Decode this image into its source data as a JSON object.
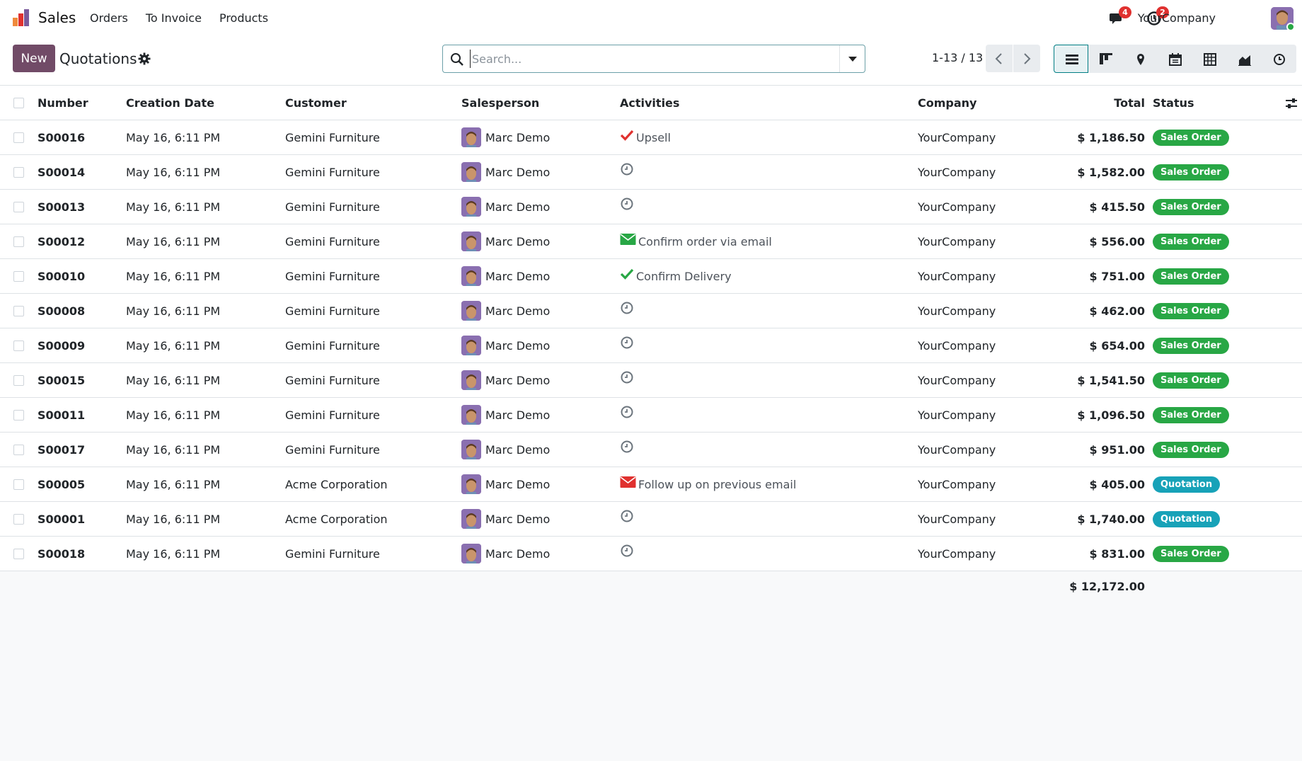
{
  "navbar": {
    "app_name": "Sales",
    "menu": [
      "Orders",
      "To Invoice",
      "Products"
    ],
    "messages_count": "4",
    "activities_count": "2",
    "company": "YourCompany"
  },
  "control": {
    "new_label": "New",
    "title": "Quotations",
    "search_placeholder": "Search...",
    "pager": "1-13 / 13",
    "views": [
      "list-icon",
      "kanban-icon",
      "map-icon",
      "calendar-icon",
      "pivot-icon",
      "graph-icon",
      "activity-icon"
    ]
  },
  "table": {
    "headers": {
      "number": "Number",
      "date": "Creation Date",
      "customer": "Customer",
      "salesperson": "Salesperson",
      "activities": "Activities",
      "company": "Company",
      "total": "Total",
      "status": "Status"
    },
    "rows": [
      {
        "number": "S00016",
        "date": "May 16, 6:11 PM",
        "customer": "Gemini Furniture",
        "salesperson": "Marc Demo",
        "activity_icon": "check-icon",
        "activity_color": "#e0312f",
        "activity": "Upsell",
        "company": "YourCompany",
        "total": "$ 1,186.50",
        "status": "Sales Order",
        "status_color": "#28a745"
      },
      {
        "number": "S00014",
        "date": "May 16, 6:11 PM",
        "customer": "Gemini Furniture",
        "salesperson": "Marc Demo",
        "activity_icon": "clock-icon",
        "activity_color": "#6c757d",
        "activity": "",
        "company": "YourCompany",
        "total": "$ 1,582.00",
        "status": "Sales Order",
        "status_color": "#28a745"
      },
      {
        "number": "S00013",
        "date": "May 16, 6:11 PM",
        "customer": "Gemini Furniture",
        "salesperson": "Marc Demo",
        "activity_icon": "clock-icon",
        "activity_color": "#6c757d",
        "activity": "",
        "company": "YourCompany",
        "total": "$ 415.50",
        "status": "Sales Order",
        "status_color": "#28a745"
      },
      {
        "number": "S00012",
        "date": "May 16, 6:11 PM",
        "customer": "Gemini Furniture",
        "salesperson": "Marc Demo",
        "activity_icon": "envelope-icon",
        "activity_color": "#28a745",
        "activity": "Confirm order via email",
        "company": "YourCompany",
        "total": "$ 556.00",
        "status": "Sales Order",
        "status_color": "#28a745"
      },
      {
        "number": "S00010",
        "date": "May 16, 6:11 PM",
        "customer": "Gemini Furniture",
        "salesperson": "Marc Demo",
        "activity_icon": "check-icon",
        "activity_color": "#28a745",
        "activity": "Confirm Delivery",
        "company": "YourCompany",
        "total": "$ 751.00",
        "status": "Sales Order",
        "status_color": "#28a745"
      },
      {
        "number": "S00008",
        "date": "May 16, 6:11 PM",
        "customer": "Gemini Furniture",
        "salesperson": "Marc Demo",
        "activity_icon": "clock-icon",
        "activity_color": "#6c757d",
        "activity": "",
        "company": "YourCompany",
        "total": "$ 462.00",
        "status": "Sales Order",
        "status_color": "#28a745"
      },
      {
        "number": "S00009",
        "date": "May 16, 6:11 PM",
        "customer": "Gemini Furniture",
        "salesperson": "Marc Demo",
        "activity_icon": "clock-icon",
        "activity_color": "#6c757d",
        "activity": "",
        "company": "YourCompany",
        "total": "$ 654.00",
        "status": "Sales Order",
        "status_color": "#28a745"
      },
      {
        "number": "S00015",
        "date": "May 16, 6:11 PM",
        "customer": "Gemini Furniture",
        "salesperson": "Marc Demo",
        "activity_icon": "clock-icon",
        "activity_color": "#6c757d",
        "activity": "",
        "company": "YourCompany",
        "total": "$ 1,541.50",
        "status": "Sales Order",
        "status_color": "#28a745"
      },
      {
        "number": "S00011",
        "date": "May 16, 6:11 PM",
        "customer": "Gemini Furniture",
        "salesperson": "Marc Demo",
        "activity_icon": "clock-icon",
        "activity_color": "#6c757d",
        "activity": "",
        "company": "YourCompany",
        "total": "$ 1,096.50",
        "status": "Sales Order",
        "status_color": "#28a745"
      },
      {
        "number": "S00017",
        "date": "May 16, 6:11 PM",
        "customer": "Gemini Furniture",
        "salesperson": "Marc Demo",
        "activity_icon": "clock-icon",
        "activity_color": "#6c757d",
        "activity": "",
        "company": "YourCompany",
        "total": "$ 951.00",
        "status": "Sales Order",
        "status_color": "#28a745"
      },
      {
        "number": "S00005",
        "date": "May 16, 6:11 PM",
        "customer": "Acme Corporation",
        "salesperson": "Marc Demo",
        "activity_icon": "envelope-icon",
        "activity_color": "#e0312f",
        "activity": "Follow up on previous email",
        "company": "YourCompany",
        "total": "$ 405.00",
        "status": "Quotation",
        "status_color": "#17a2b8"
      },
      {
        "number": "S00001",
        "date": "May 16, 6:11 PM",
        "customer": "Acme Corporation",
        "salesperson": "Marc Demo",
        "activity_icon": "clock-icon",
        "activity_color": "#6c757d",
        "activity": "",
        "company": "YourCompany",
        "total": "$ 1,740.00",
        "status": "Quotation",
        "status_color": "#17a2b8"
      },
      {
        "number": "S00018",
        "date": "May 16, 6:11 PM",
        "customer": "Gemini Furniture",
        "salesperson": "Marc Demo",
        "activity_icon": "clock-icon",
        "activity_color": "#6c757d",
        "activity": "",
        "company": "YourCompany",
        "total": "$ 831.00",
        "status": "Sales Order",
        "status_color": "#28a745"
      }
    ],
    "grand_total": "$ 12,172.00"
  }
}
